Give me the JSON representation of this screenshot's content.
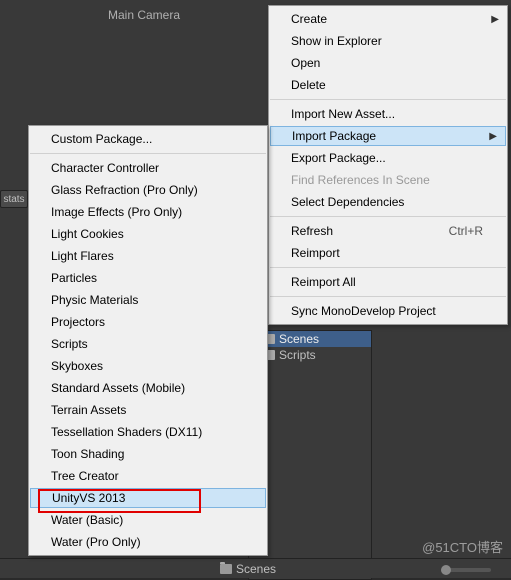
{
  "hierarchy": {
    "main_camera": "Main Camera"
  },
  "stats_btn": "stats",
  "project": {
    "folders": [
      {
        "name": "Scenes",
        "selected": true
      },
      {
        "name": "Scripts",
        "selected": false
      }
    ]
  },
  "bottom_bar": {
    "path": "Scenes"
  },
  "main_menu": {
    "items": [
      {
        "label": "Create",
        "arrow": true
      },
      {
        "label": "Show in Explorer"
      },
      {
        "label": "Open"
      },
      {
        "label": "Delete"
      },
      {
        "sep": true
      },
      {
        "label": "Import New Asset..."
      },
      {
        "label": "Import Package",
        "arrow": true,
        "highlighted": true
      },
      {
        "label": "Export Package..."
      },
      {
        "label": "Find References In Scene",
        "disabled": true
      },
      {
        "label": "Select Dependencies"
      },
      {
        "sep": true
      },
      {
        "label": "Refresh",
        "shortcut": "Ctrl+R"
      },
      {
        "label": "Reimport"
      },
      {
        "sep": true
      },
      {
        "label": "Reimport All"
      },
      {
        "sep": true
      },
      {
        "label": "Sync MonoDevelop Project"
      }
    ]
  },
  "sub_menu": {
    "items": [
      {
        "label": "Custom Package..."
      },
      {
        "sep": true
      },
      {
        "label": "Character Controller"
      },
      {
        "label": "Glass Refraction (Pro Only)"
      },
      {
        "label": "Image Effects (Pro Only)"
      },
      {
        "label": "Light Cookies"
      },
      {
        "label": "Light Flares"
      },
      {
        "label": "Particles"
      },
      {
        "label": "Physic Materials"
      },
      {
        "label": "Projectors"
      },
      {
        "label": "Scripts"
      },
      {
        "label": "Skyboxes"
      },
      {
        "label": "Standard Assets (Mobile)"
      },
      {
        "label": "Terrain Assets"
      },
      {
        "label": "Tessellation Shaders (DX11)"
      },
      {
        "label": "Toon Shading"
      },
      {
        "label": "Tree Creator"
      },
      {
        "label": "UnityVS 2013",
        "highlighted": true
      },
      {
        "label": "Water (Basic)"
      },
      {
        "label": "Water (Pro Only)"
      }
    ]
  },
  "watermark": "@51CTO博客"
}
